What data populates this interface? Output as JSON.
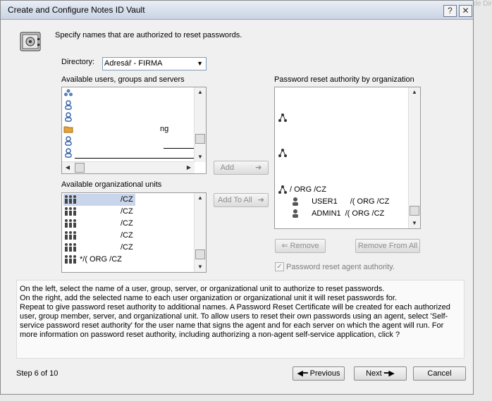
{
  "background_text": "Ude Dir",
  "window": {
    "title": "Create and Configure Notes ID Vault",
    "help_button": "?",
    "close_button": "✕"
  },
  "intro": "Specify names that are authorized to reset passwords.",
  "directory": {
    "label": "Directory:",
    "value": "Adresář -  FIRMA"
  },
  "available_users": {
    "label": "Available users, groups and servers",
    "items": [
      {
        "icon": "group-icon",
        "text": ""
      },
      {
        "icon": "person-icon",
        "text": ""
      },
      {
        "icon": "person-icon",
        "text": ""
      },
      {
        "icon": "folder-icon",
        "text": "ng"
      },
      {
        "icon": "person-icon",
        "text": ""
      },
      {
        "icon": "person-icon",
        "text": ""
      }
    ]
  },
  "available_org_units": {
    "label": "Available organizational units",
    "items": [
      {
        "text": "/CZ"
      },
      {
        "text": "/CZ"
      },
      {
        "text": "/CZ"
      },
      {
        "text": "/CZ"
      },
      {
        "text": "/CZ"
      },
      {
        "text": "*/( ORG /CZ"
      }
    ]
  },
  "password_reset": {
    "label": "Password reset authority by organization",
    "org_line": "/  ORG /CZ",
    "users": [
      {
        "name": "USER1",
        "org": "/( ORG /CZ"
      },
      {
        "name": "ADMIN1",
        "org": "/( ORG  /CZ"
      }
    ]
  },
  "buttons": {
    "add": "Add",
    "add_to_all": "Add To All",
    "remove": "Remove",
    "remove_from_all": "Remove From All",
    "previous": "Previous",
    "next": "Next",
    "cancel": "Cancel"
  },
  "agent_checkbox": {
    "label": "Password reset agent authority.",
    "checked": true
  },
  "description": [
    "On the left, select the name of a user, group, server, or organizational unit to authorize to reset passwords.",
    "On the right, add the selected name to each user organization or organizational unit it will reset passwords for.",
    "Repeat to give password reset authority to additional names.  A Password Reset Certificate will be created for each authorized user, group member, server, and organizational unit. To allow users to reset their own passwords using an agent, select 'Self-service password reset authority' for the user name that signs the agent and for each server on which the agent will run. For more information on password reset authority, including authorizing a non-agent self-service application, click ?"
  ],
  "step": "Step 6 of 10"
}
